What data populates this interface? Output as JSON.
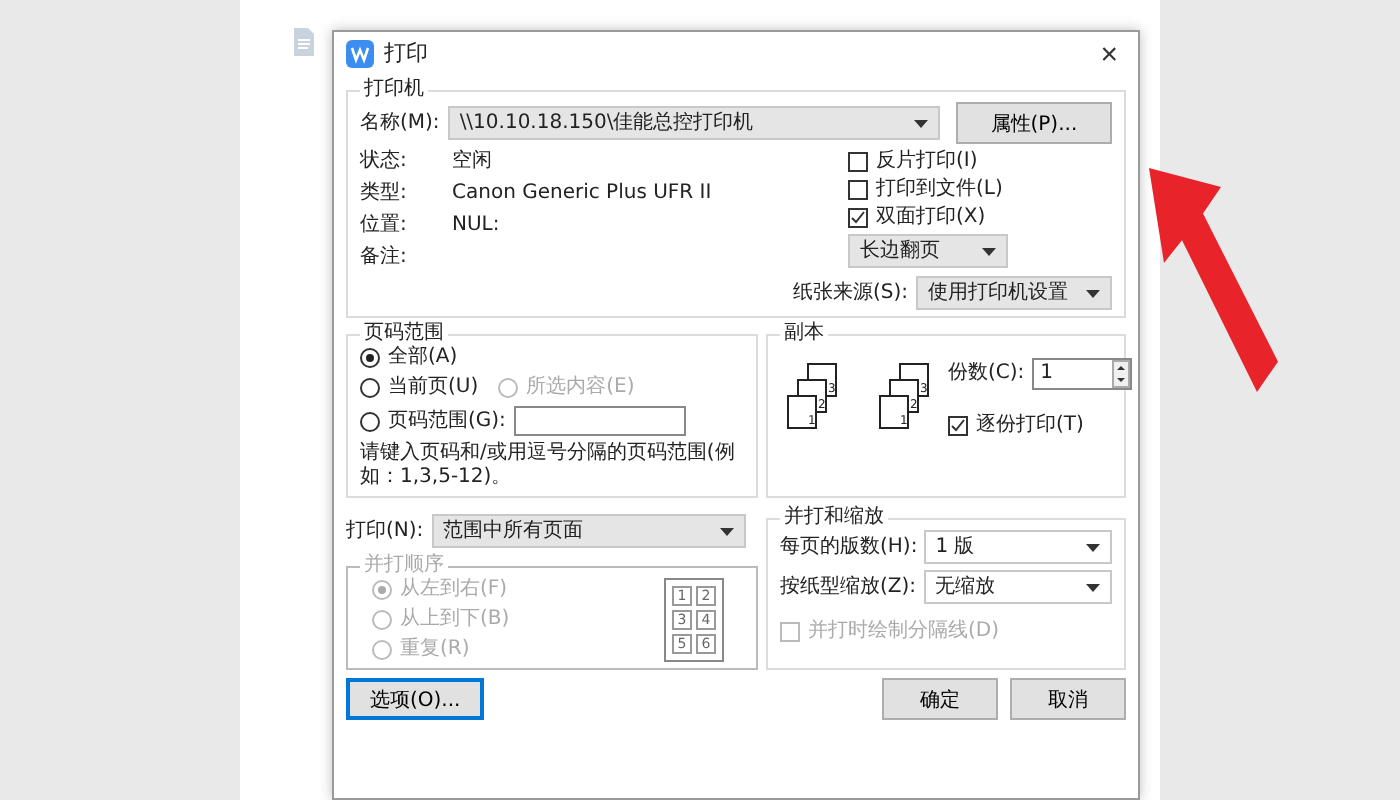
{
  "window": {
    "title": "打印",
    "close": "×"
  },
  "printer": {
    "legend": "打印机",
    "name_label": "名称(M):",
    "name_value": "\\\\10.10.18.150\\佳能总控打印机",
    "properties_button": "属性(P)...",
    "info": [
      {
        "label": "状态:",
        "value": "空闲"
      },
      {
        "label": "类型:",
        "value": "Canon Generic Plus UFR II"
      },
      {
        "label": "位置:",
        "value": "NUL:"
      },
      {
        "label": "备注:"
      }
    ],
    "options": [
      {
        "label": "反片打印(I)",
        "checked": false
      },
      {
        "label": "打印到文件(L)",
        "checked": false
      },
      {
        "label": "双面打印(X)",
        "checked": true
      }
    ],
    "duplex_select": "长边翻页",
    "paper_source": {
      "label": "纸张来源(S):",
      "value": "使用打印机设置"
    }
  },
  "page_range": {
    "legend": "页码范围",
    "options": [
      {
        "label": "全部(A)",
        "selected": true,
        "disabled": false
      },
      {
        "label": "当前页(U)",
        "selected": false,
        "disabled": false
      },
      {
        "label": "所选内容(E)",
        "selected": false,
        "disabled": true
      },
      {
        "label": "页码范围(G):",
        "selected": false,
        "disabled": false
      }
    ],
    "hint": "请键入页码和/或用逗号分隔的页码范围(例如：1,3,5-12)。"
  },
  "copies": {
    "legend": "副本",
    "stacks": [
      [
        "1",
        "2",
        "3"
      ],
      [
        "1",
        "2",
        "3"
      ]
    ],
    "count_label": "份数(C):",
    "count_value": "1",
    "collate": {
      "label": "逐份打印(T)",
      "checked": true
    }
  },
  "print_select": {
    "label": "打印(N):",
    "value": "范围中所有页面"
  },
  "order": {
    "legend": "并打顺序",
    "disabled": true,
    "options": [
      {
        "label": "从左到右(F)",
        "selected": true
      },
      {
        "label": "从上到下(B)",
        "selected": false
      },
      {
        "label": "重复(R)",
        "selected": false
      }
    ],
    "grid": [
      "1",
      "2",
      "3",
      "4",
      "5",
      "6"
    ]
  },
  "scale": {
    "legend": "并打和缩放",
    "rows": [
      {
        "label": "每页的版数(H):",
        "value": "1 版"
      },
      {
        "label": "按纸型缩放(Z):",
        "value": "无缩放"
      }
    ],
    "separator": {
      "label": "并打时绘制分隔线(D)",
      "checked": false,
      "disabled": true
    }
  },
  "buttons": {
    "options": "选项(O)...",
    "ok": "确定",
    "cancel": "取消"
  }
}
